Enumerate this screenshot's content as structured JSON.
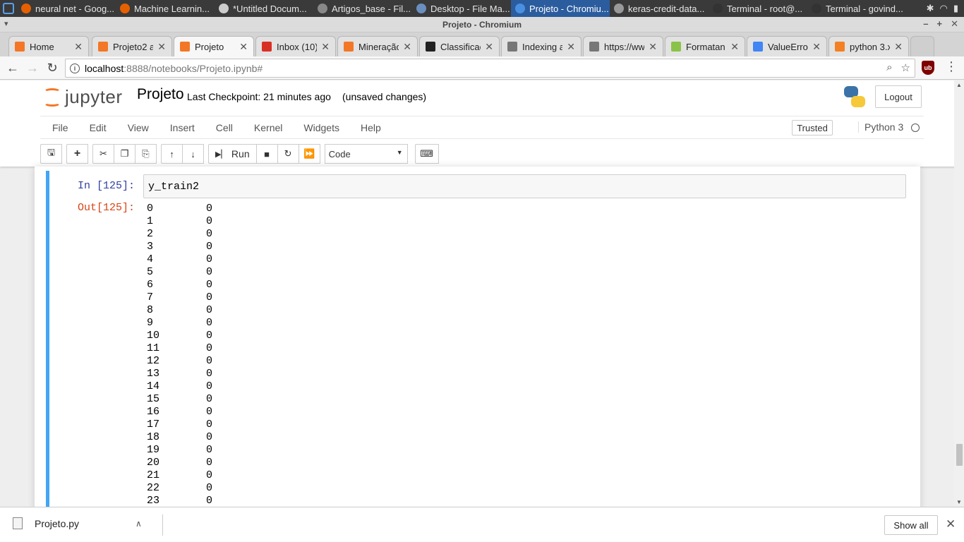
{
  "taskbar": {
    "tasks": [
      {
        "label": "neural net - Goog...",
        "color": "#e66000"
      },
      {
        "label": "Machine Learnin...",
        "color": "#e66000"
      },
      {
        "label": "*Untitled Docum...",
        "color": "#cccccc"
      },
      {
        "label": "Artigos_base - Fil...",
        "color": "#888888"
      },
      {
        "label": "Desktop - File Ma...",
        "color": "#6a8fbf"
      },
      {
        "label": "Projeto - Chromiu...",
        "color": "#4a90e2"
      },
      {
        "label": "keras-credit-data...",
        "color": "#999999"
      },
      {
        "label": "Terminal - root@...",
        "color": "#333333"
      },
      {
        "label": "Terminal - govind...",
        "color": "#333333"
      }
    ],
    "tray": {
      "bluetooth": "bluetooth-icon",
      "wifi": "wifi-icon",
      "battery": "battery-icon"
    }
  },
  "window": {
    "title": "Projeto - Chromium"
  },
  "tabs": [
    {
      "label": "Home",
      "icon": "jupyter-icon",
      "color": "#f37726"
    },
    {
      "label": "Projeto2 a",
      "icon": "notebook-icon",
      "color": "#f37726"
    },
    {
      "label": "Projeto",
      "icon": "notebook-icon",
      "color": "#f37726"
    },
    {
      "label": "Inbox (10)",
      "icon": "gmail-icon",
      "color": "#d93025"
    },
    {
      "label": "Mineração",
      "icon": "notebook-icon",
      "color": "#f37726"
    },
    {
      "label": "Classificaç",
      "icon": "a-icon",
      "color": "#222222"
    },
    {
      "label": "Indexing a",
      "icon": "page-icon",
      "color": "#777777"
    },
    {
      "label": "https://ww",
      "icon": "page-icon",
      "color": "#777777"
    },
    {
      "label": "Formatan",
      "icon": "dot-icon",
      "color": "#8bc34a"
    },
    {
      "label": "ValueErro",
      "icon": "google-icon",
      "color": "#4285f4"
    },
    {
      "label": "python 3.x",
      "icon": "stack-icon",
      "color": "#f48024"
    }
  ],
  "omnibox": {
    "host": "localhost",
    "path": ":8888/notebooks/Projeto.ipynb#"
  },
  "jupyter": {
    "logo_word": "jupyter",
    "notebook_name": "Projeto",
    "checkpoint": "Last Checkpoint: 21 minutes ago",
    "unsaved": "(unsaved changes)",
    "logout": "Logout",
    "menu": [
      "File",
      "Edit",
      "View",
      "Insert",
      "Cell",
      "Kernel",
      "Widgets",
      "Help"
    ],
    "trusted": "Trusted",
    "kernel": "Python 3",
    "run_label": "Run",
    "cell_type": "Code"
  },
  "cell": {
    "in_prompt": "In [125]:",
    "code": "y_train2",
    "out_prompt": "Out[125]:",
    "rows": [
      [
        "0",
        "0"
      ],
      [
        "1",
        "0"
      ],
      [
        "2",
        "0"
      ],
      [
        "3",
        "0"
      ],
      [
        "4",
        "0"
      ],
      [
        "5",
        "0"
      ],
      [
        "6",
        "0"
      ],
      [
        "7",
        "0"
      ],
      [
        "8",
        "0"
      ],
      [
        "9",
        "0"
      ],
      [
        "10",
        "0"
      ],
      [
        "11",
        "0"
      ],
      [
        "12",
        "0"
      ],
      [
        "13",
        "0"
      ],
      [
        "14",
        "0"
      ],
      [
        "15",
        "0"
      ],
      [
        "16",
        "0"
      ],
      [
        "17",
        "0"
      ],
      [
        "18",
        "0"
      ],
      [
        "19",
        "0"
      ],
      [
        "20",
        "0"
      ],
      [
        "21",
        "0"
      ],
      [
        "22",
        "0"
      ],
      [
        "23",
        "0"
      ]
    ]
  },
  "downloads": {
    "file": "Projeto.py",
    "show_all": "Show all"
  }
}
